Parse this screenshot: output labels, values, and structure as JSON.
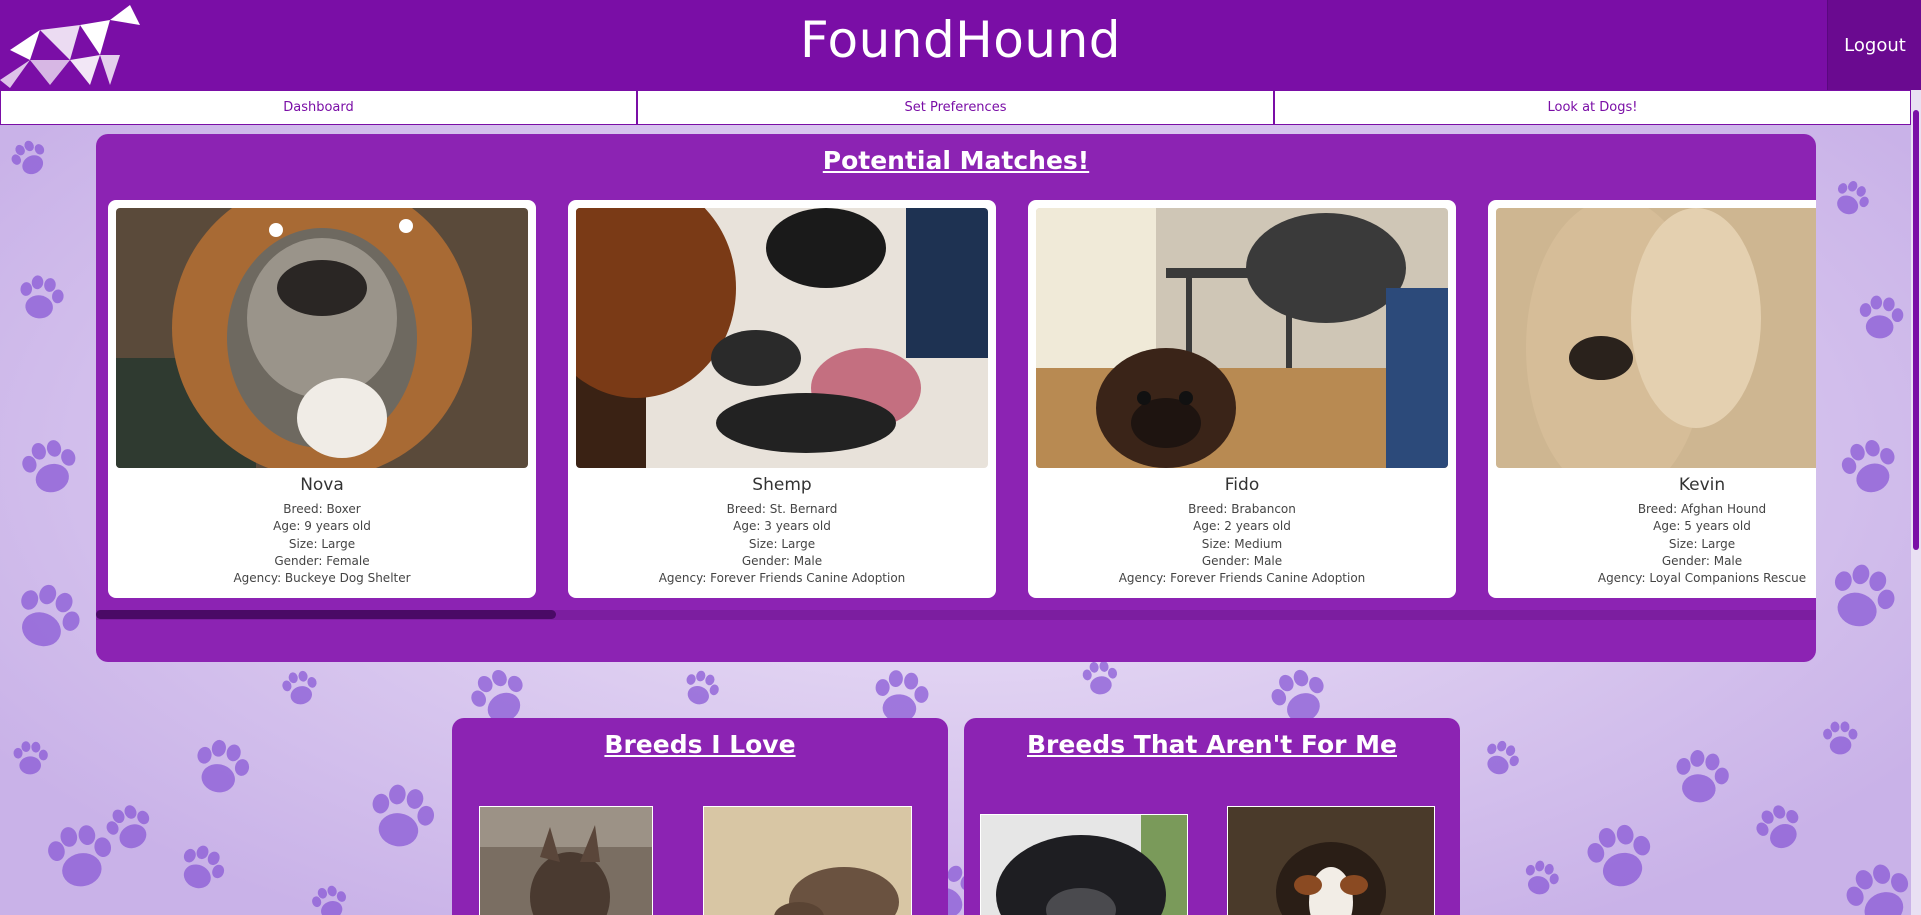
{
  "header": {
    "title": "FoundHound",
    "logout_label": "Logout",
    "logo_icon": "origami-dog-logo"
  },
  "nav": {
    "items": [
      {
        "label": "Dashboard"
      },
      {
        "label": "Set Preferences"
      },
      {
        "label": "Look at Dogs!"
      }
    ]
  },
  "matches": {
    "title": "Potential Matches!",
    "cards": [
      {
        "name": "Nova",
        "breed": "Breed: Boxer",
        "age": "Age: 9 years old",
        "size": "Size: Large",
        "gender": "Gender: Female",
        "agency": "Agency: Buckeye Dog Shelter"
      },
      {
        "name": "Shemp",
        "breed": "Breed: St. Bernard",
        "age": "Age: 3 years old",
        "size": "Size: Large",
        "gender": "Gender: Male",
        "agency": "Agency: Forever Friends Canine Adoption"
      },
      {
        "name": "Fido",
        "breed": "Breed: Brabancon",
        "age": "Age: 2 years old",
        "size": "Size: Medium",
        "gender": "Gender: Male",
        "agency": "Agency: Forever Friends Canine Adoption"
      },
      {
        "name": "Kevin",
        "breed": "Breed: Afghan Hound",
        "age": "Age: 5 years old",
        "size": "Size: Large",
        "gender": "Gender: Male",
        "agency": "Agency: Loyal Companions Rescue"
      }
    ]
  },
  "breeds_love": {
    "title": "Breeds I Love"
  },
  "breeds_not": {
    "title": "Breeds That Aren't For Me"
  },
  "colors": {
    "brand_purple": "#7a0ea6",
    "panel_purple": "#8c23b3",
    "background_lavender": "#d9c8ee"
  }
}
